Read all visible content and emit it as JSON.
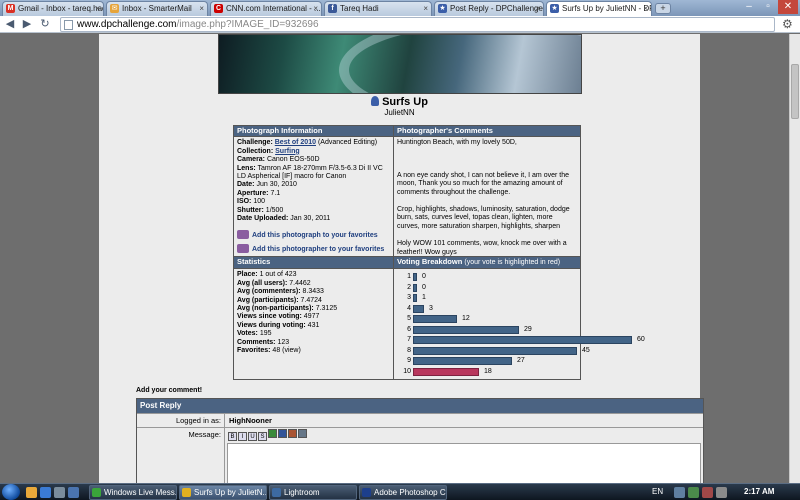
{
  "browser": {
    "tabs": [
      {
        "label": "Gmail - Inbox - tareq.had...",
        "icon": "gmail-icon",
        "color": "#d93025"
      },
      {
        "label": "Inbox - SmarterMail",
        "icon": "smartermail-icon",
        "color": "#e6a43a"
      },
      {
        "label": "CNN.com International - ...",
        "icon": "cnn-icon",
        "color": "#c00"
      },
      {
        "label": "Tareq Hadi",
        "icon": "facebook-icon",
        "color": "#3b5998"
      },
      {
        "label": "Post Reply - DPChallenge...",
        "icon": "dpchallenge-icon",
        "color": "#3b5ea8"
      },
      {
        "label": "Surfs Up by JulietNN - DP...",
        "icon": "dpchallenge-icon",
        "color": "#3b5ea8"
      }
    ],
    "url_host": "www.dpchallenge.com",
    "url_path": "/image.php?IMAGE_ID=932696"
  },
  "photo": {
    "title": "Surfs Up",
    "author": "JulietNN"
  },
  "info": {
    "header_left": "Photograph Information",
    "header_right": "Photographer's Comments",
    "challenge_label": "Challenge:",
    "challenge_link": "Best of 2010",
    "challenge_note": "(Advanced Editing)",
    "collection_label": "Collection:",
    "collection_link": "Surfing",
    "camera_label": "Camera:",
    "camera": "Canon EOS-50D",
    "lens_label": "Lens:",
    "lens": "Tamron AF 18-270mm F/3.5-6.3 Di II VC LD Aspherical [IF] macro for Canon",
    "date_label": "Date:",
    "date": "Jun 30, 2010",
    "aperture_label": "Aperture:",
    "aperture": "7.1",
    "iso_label": "ISO:",
    "iso": "100",
    "shutter_label": "Shutter:",
    "shutter": "1/500",
    "uploaded_label": "Date Uploaded:",
    "uploaded": "Jan 30, 2011",
    "fav_photo": "Add this photograph to your favorites",
    "fav_photographer": "Add this photographer to your favorites",
    "comments": [
      "Huntington Beach, with my lovely 50D,",
      "A non eye candy shot, I can not believe it, I am over the moon, Thank you so much for the amazing amount of comments throughout the challenge.",
      "Crop, highlights, shadows, luminosity, saturation, dodge burn, sats, curves level, topas clean, lighten, more curves, more saturation sharpen, highlights, sharpen",
      "Holy WOW 101 comments, wow, knock me over with a feather!! Wow guys"
    ]
  },
  "stats": {
    "header_left": "Statistics",
    "header_right": "Voting Breakdown",
    "header_right_note": "(your vote is highlighted in red)",
    "place_label": "Place:",
    "place": "1 out of 423",
    "avg_all_label": "Avg (all users):",
    "avg_all": "7.4462",
    "avg_commenters_label": "Avg (commenters):",
    "avg_commenters": "8.3433",
    "avg_participants_label": "Avg (participants):",
    "avg_participants": "7.4724",
    "avg_non_label": "Avg (non-participants):",
    "avg_non": "7.3125",
    "views_since_label": "Views since voting:",
    "views_since": "4977",
    "views_during_label": "Views during voting:",
    "views_during": "431",
    "votes_label": "Votes:",
    "votes": "195",
    "comments_label": "Comments:",
    "comments": "123",
    "favorites_label": "Favorites:",
    "favorites": "48 (view)",
    "breakdown": [
      {
        "score": "1",
        "count": 0,
        "mine": false
      },
      {
        "score": "2",
        "count": 0,
        "mine": false
      },
      {
        "score": "3",
        "count": 1,
        "mine": false
      },
      {
        "score": "4",
        "count": 3,
        "mine": false
      },
      {
        "score": "5",
        "count": 12,
        "mine": false
      },
      {
        "score": "6",
        "count": 29,
        "mine": false
      },
      {
        "score": "7",
        "count": 60,
        "mine": false
      },
      {
        "score": "8",
        "count": 45,
        "mine": false
      },
      {
        "score": "9",
        "count": 27,
        "mine": false
      },
      {
        "score": "10",
        "count": 18,
        "mine": true
      }
    ]
  },
  "reply": {
    "add_comment": "Add your comment!",
    "header": "Post Reply",
    "logged_label": "Logged in as:",
    "logged_user": "HighNooner",
    "message_label": "Message:",
    "format_buttons": [
      "B",
      "I",
      "U",
      "S",
      "",
      "",
      "",
      ""
    ]
  },
  "taskbar": {
    "items": [
      {
        "label": "Windows Live Mess...",
        "icon": "messenger-icon",
        "color": "#3aa53a"
      },
      {
        "label": "Surfs Up by JulietN...",
        "icon": "chrome-icon",
        "color": "#e0b020"
      },
      {
        "label": "Lightroom",
        "icon": "lightroom-icon",
        "color": "#3d6aa1"
      },
      {
        "label": "Adobe Photoshop C...",
        "icon": "photoshop-icon",
        "color": "#1d3f8c"
      }
    ],
    "lang": "EN",
    "time": "2:17 AM"
  }
}
